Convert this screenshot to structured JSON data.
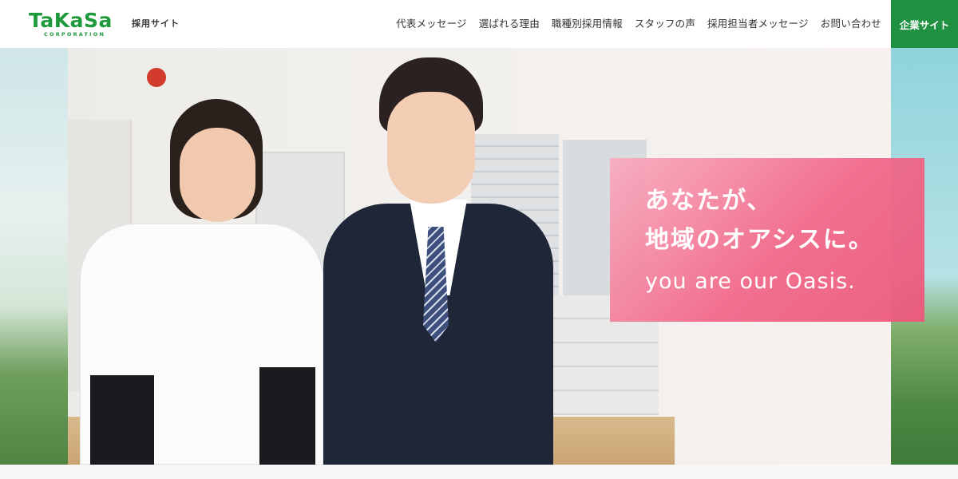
{
  "header": {
    "logo_main": "TaKaSa",
    "logo_sub": "CORPORATION",
    "site_label": "採用サイト",
    "nav": [
      {
        "label": "代表メッセージ"
      },
      {
        "label": "選ばれる理由"
      },
      {
        "label": "職種別採用情報"
      },
      {
        "label": "スタッフの声"
      },
      {
        "label": "採用担当者メッセージ"
      },
      {
        "label": "お問い合わせ"
      }
    ],
    "corporate_button": "企業サイト"
  },
  "hero": {
    "catch_line1": "あなたが、",
    "catch_line2": "地域のオアシスに。",
    "catch_line3": "you are our Oasis."
  },
  "colors": {
    "brand_green": "#1f9140",
    "catch_pink": "#f1688a",
    "text": "#333333"
  }
}
